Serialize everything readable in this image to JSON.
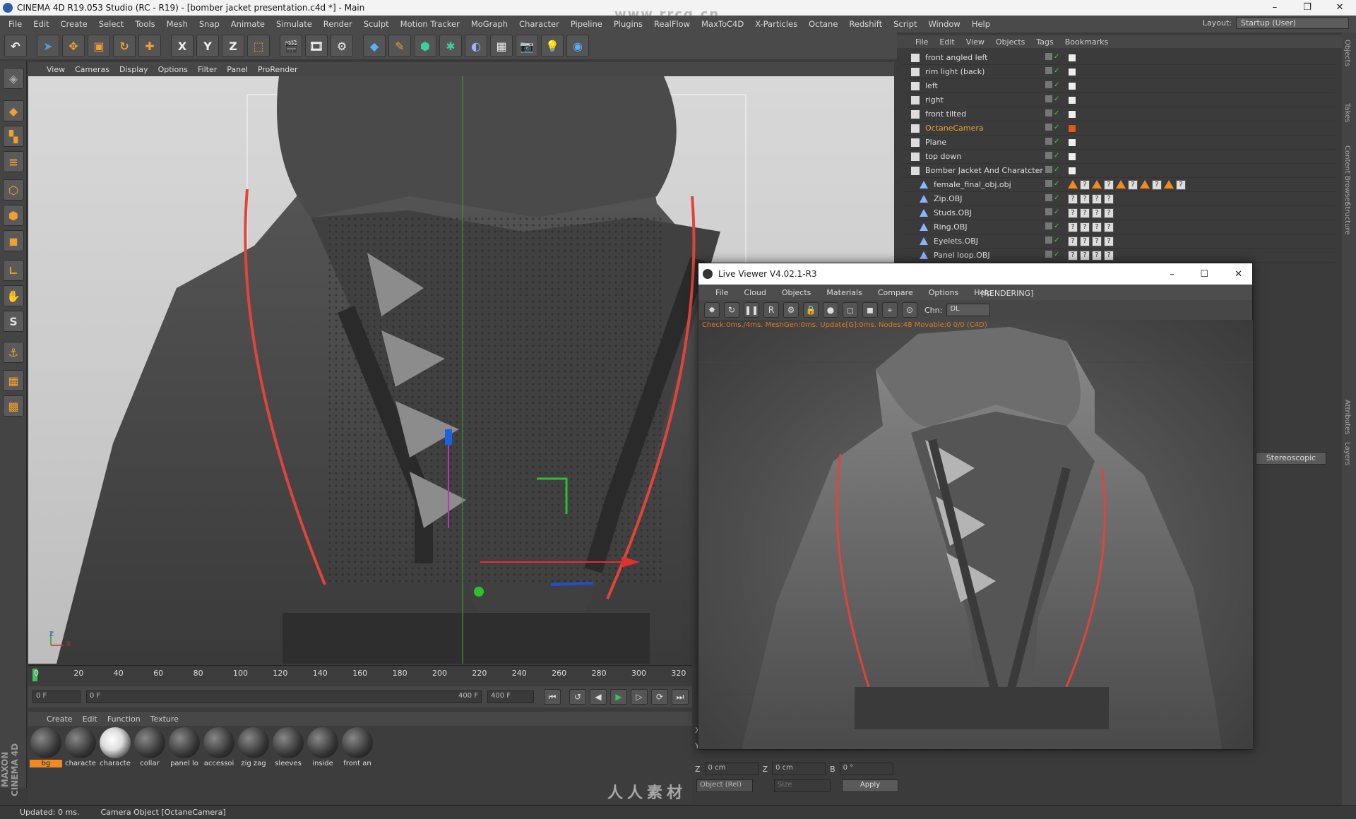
{
  "window": {
    "title": "CINEMA 4D R19.053 Studio (RC - R19) - [bomber jacket presentation.c4d *] - Main",
    "minimize": "–",
    "restore": "❐",
    "close": "✕"
  },
  "menubar": [
    "File",
    "Edit",
    "Create",
    "Select",
    "Tools",
    "Mesh",
    "Snap",
    "Animate",
    "Simulate",
    "Render",
    "Sculpt",
    "Motion Tracker",
    "MoGraph",
    "Character",
    "Pipeline",
    "Plugins",
    "RealFlow",
    "MaxToC4D",
    "X-Particles",
    "Octane",
    "Redshift",
    "Script",
    "Window",
    "Help"
  ],
  "layout": {
    "label": "Layout:",
    "value": "Startup (User)"
  },
  "toolbar": {
    "axis_x": "X",
    "axis_y": "Y",
    "axis_z": "Z"
  },
  "viewport": {
    "menu": [
      "View",
      "Cameras",
      "Display",
      "Options",
      "Filter",
      "Panel",
      "ProRender"
    ],
    "axes_label_z": "Z",
    "axes_label_x": "X"
  },
  "timeline": {
    "ticks": [
      "0",
      "20",
      "40",
      "60",
      "80",
      "100",
      "120",
      "140",
      "160",
      "180",
      "200",
      "220",
      "240",
      "260",
      "280",
      "300",
      "320"
    ]
  },
  "transport": {
    "start_frame": "0 F",
    "range_left": "0 F",
    "range_right": "400 F",
    "end_frame": "400 F"
  },
  "materials": {
    "menu": [
      "Create",
      "Edit",
      "Function",
      "Texture"
    ],
    "items": [
      "bg",
      "characte",
      "characte",
      "collar",
      "panel lo",
      "accessoi",
      "zig zag",
      "sleeves",
      "inside",
      "front an"
    ]
  },
  "status": {
    "updated": "Updated: 0 ms.",
    "selection": "Camera Object [OctaneCamera]"
  },
  "maxon_logo": "MAXON CINEMA 4D",
  "object_manager": {
    "menu": [
      "File",
      "Edit",
      "View",
      "Objects",
      "Tags",
      "Bookmarks"
    ],
    "rows": [
      {
        "name": "front angled left",
        "indent": 0
      },
      {
        "name": "rim light (back)",
        "indent": 0
      },
      {
        "name": "left",
        "indent": 0
      },
      {
        "name": "right",
        "indent": 0
      },
      {
        "name": "front tilted",
        "indent": 0
      },
      {
        "name": "OctaneCamera",
        "indent": 0,
        "selected": true
      },
      {
        "name": "Plane",
        "indent": 0
      },
      {
        "name": "top down",
        "indent": 0
      },
      {
        "name": "Bomber Jacket And Charatcter",
        "indent": 0
      },
      {
        "name": "female_final_obj.obj",
        "indent": 1
      },
      {
        "name": "Zip.OBJ",
        "indent": 1
      },
      {
        "name": "Studs.OBJ",
        "indent": 1
      },
      {
        "name": "Ring.OBJ",
        "indent": 1
      },
      {
        "name": "Eyelets.OBJ",
        "indent": 1
      },
      {
        "name": "Panel loop.OBJ",
        "indent": 1
      }
    ]
  },
  "attributes": {
    "stereoscopic_button": "Stereoscopic"
  },
  "right_strip": [
    "Objects",
    "Takes",
    "Content Browser",
    "Structure",
    "Attributes",
    "Layers"
  ],
  "coords": {
    "x_label": "X",
    "y_label": "Y",
    "z_label": "Z",
    "z_pos": "0 cm",
    "z_size_label": "Z",
    "z_size": "0 cm",
    "b_label": "B",
    "b_rot": "0 °",
    "mode": "Object (Rel)",
    "size_mode": "Size",
    "apply": "Apply"
  },
  "live_viewer": {
    "title": "Live Viewer V4.02.1-R3",
    "menu": [
      "File",
      "Cloud",
      "Objects",
      "Materials",
      "Compare",
      "Options",
      "Help"
    ],
    "state": "[RENDERING]",
    "channel_label": "Chn:",
    "channel_value": "DL",
    "status_text": "Check:0ms./4ms. MeshGen:0ms. Update[G]:0ms. Nodes:48 Movable:0 0/0 (C4D)"
  },
  "watermark": {
    "brand": "人人素材",
    "site": "www.rrcg.cn"
  },
  "colors": {
    "accent_orange": "#f08a20",
    "selected_text": "#f0a030",
    "piping_red": "#e0453a"
  }
}
